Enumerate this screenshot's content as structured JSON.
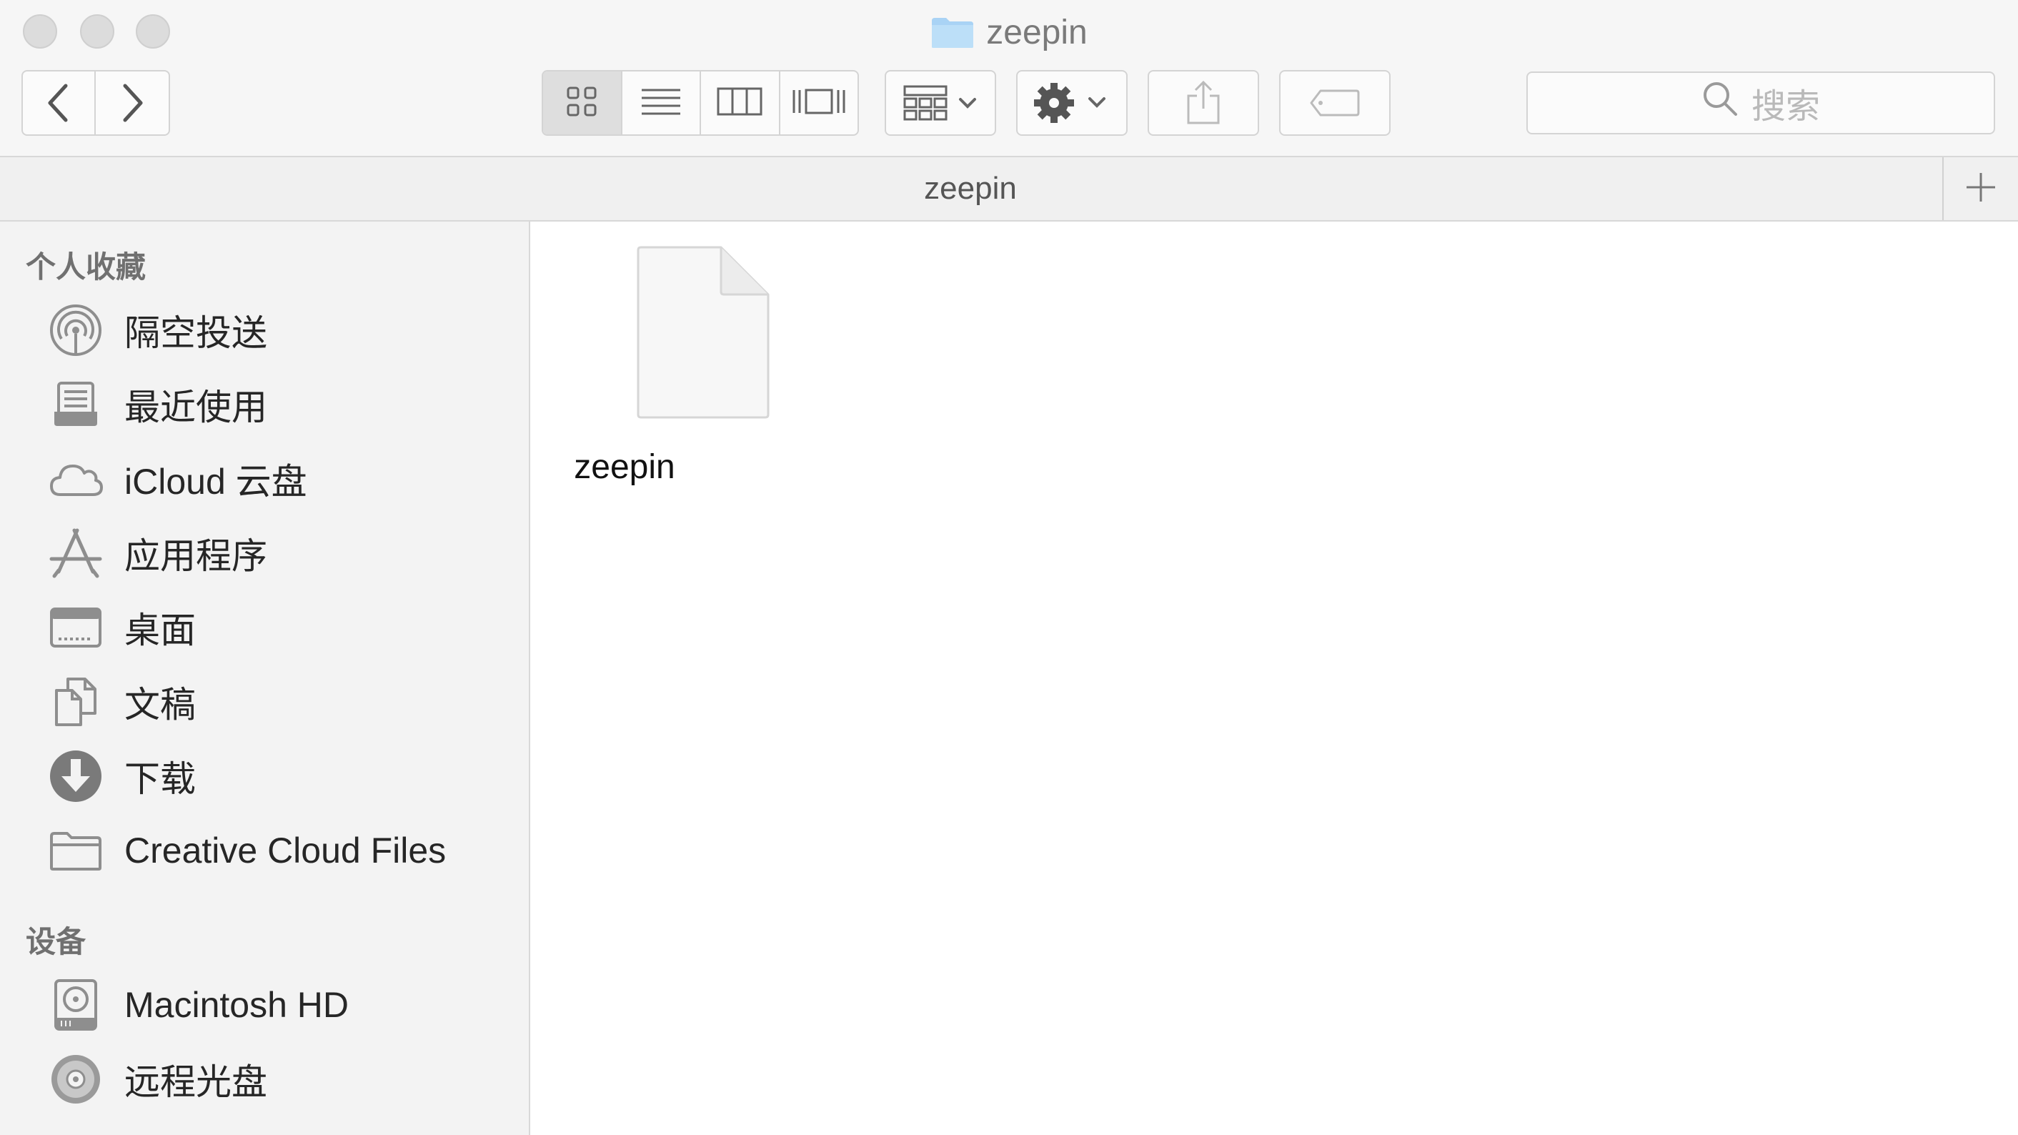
{
  "window": {
    "title": "zeepin"
  },
  "toolbar": {
    "back_icon": "chevron-left-icon",
    "forward_icon": "chevron-right-icon",
    "view_modes": [
      "icon-view",
      "list-view",
      "column-view",
      "cover-flow-view"
    ],
    "active_view": "icon-view",
    "arrange_icon": "arrange-grid-icon",
    "action_icon": "gear-icon",
    "share_icon": "share-icon",
    "tags_icon": "tag-icon",
    "search_placeholder": "搜索"
  },
  "pathbar": {
    "label": "zeepin",
    "add_icon": "plus-icon"
  },
  "sidebar": {
    "favorites_heading": "个人收藏",
    "favorites": [
      {
        "label": "隔空投送",
        "icon": "airdrop-icon"
      },
      {
        "label": "最近使用",
        "icon": "recents-icon"
      },
      {
        "label": "iCloud 云盘",
        "icon": "cloud-icon"
      },
      {
        "label": "应用程序",
        "icon": "applications-icon"
      },
      {
        "label": "桌面",
        "icon": "desktop-icon"
      },
      {
        "label": "文稿",
        "icon": "documents-icon"
      },
      {
        "label": "下载",
        "icon": "downloads-icon"
      },
      {
        "label": "Creative Cloud Files",
        "icon": "folder-icon"
      }
    ],
    "devices_heading": "设备",
    "devices": [
      {
        "label": "Macintosh HD",
        "icon": "hard-drive-icon"
      },
      {
        "label": "远程光盘",
        "icon": "optical-disc-icon"
      }
    ]
  },
  "content": {
    "files": [
      {
        "name": "zeepin",
        "icon": "document-icon"
      }
    ]
  },
  "colors": {
    "toolbar_bg": "#f6f6f6",
    "sidebar_bg": "#f3f3f3",
    "icon_gray": "#8e8e8e",
    "folder_blue": "#a9d3f5"
  }
}
